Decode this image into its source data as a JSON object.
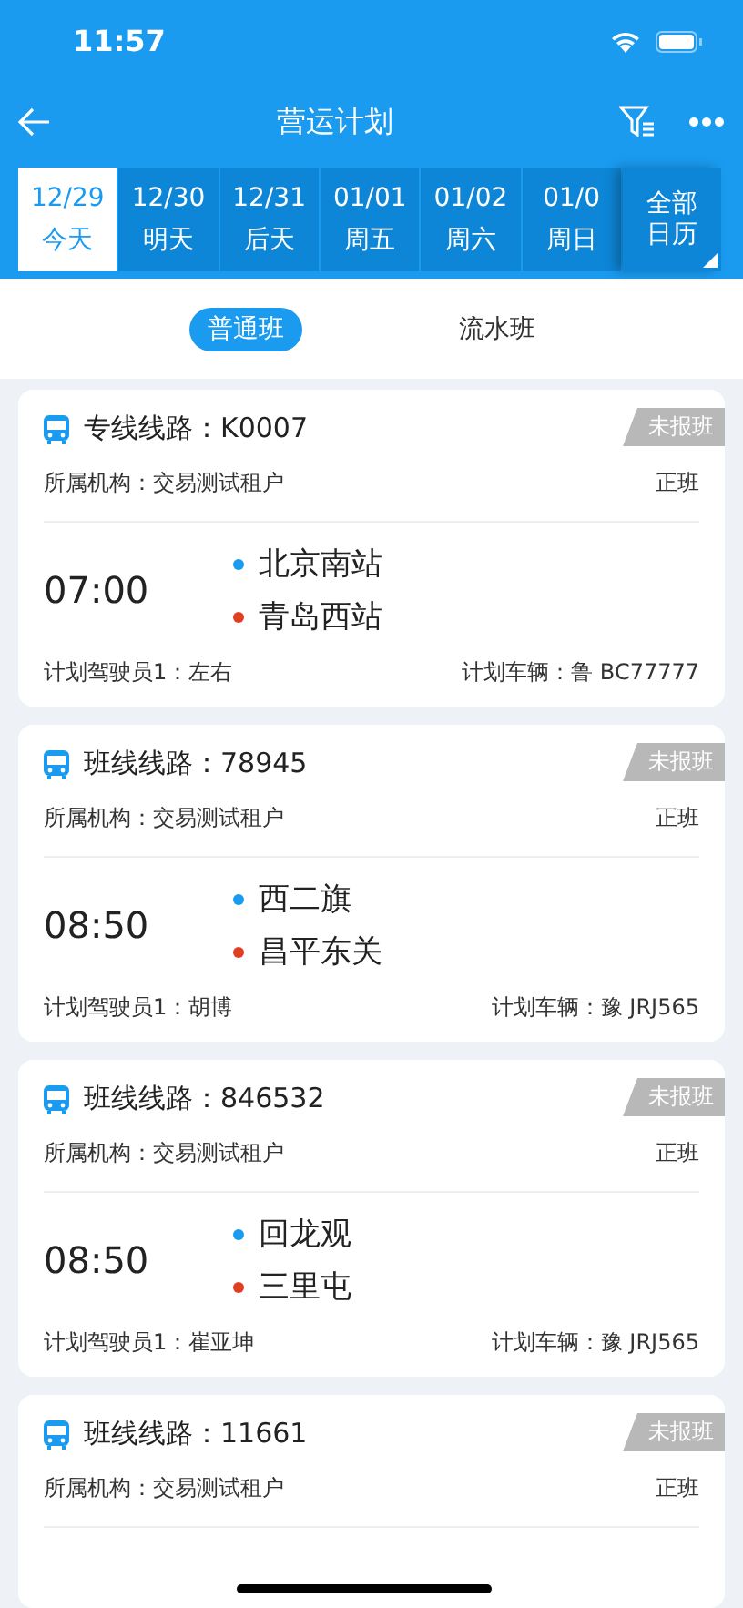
{
  "status_bar": {
    "time": "11:57"
  },
  "nav": {
    "title": "营运计划"
  },
  "dates": [
    {
      "date": "12/29",
      "day": "今天",
      "selected": true
    },
    {
      "date": "12/30",
      "day": "明天",
      "selected": false
    },
    {
      "date": "12/31",
      "day": "后天",
      "selected": false
    },
    {
      "date": "01/01",
      "day": "周五",
      "selected": false
    },
    {
      "date": "01/02",
      "day": "周六",
      "selected": false
    },
    {
      "date": "01/0",
      "day": "周日",
      "selected": false
    }
  ],
  "calendar_button": {
    "label": "全部日历"
  },
  "segments": [
    {
      "label": "普通班",
      "selected": true
    },
    {
      "label": "流水班",
      "selected": false
    }
  ],
  "cards": [
    {
      "route": "专线线路：K0007",
      "badge": "未报班",
      "org": "所属机构：交易测试租户",
      "type": "正班",
      "time": "07:00",
      "from": "北京南站",
      "to": "青岛西站",
      "driver": "计划驾驶员1：左右",
      "vehicle": "计划车辆：鲁 BC77777"
    },
    {
      "route": "班线线路：78945",
      "badge": "未报班",
      "org": "所属机构：交易测试租户",
      "type": "正班",
      "time": "08:50",
      "from": "西二旗",
      "to": "昌平东关",
      "driver": "计划驾驶员1：胡博",
      "vehicle": "计划车辆：豫 JRJ565"
    },
    {
      "route": "班线线路：846532",
      "badge": "未报班",
      "org": "所属机构：交易测试租户",
      "type": "正班",
      "time": "08:50",
      "from": "回龙观",
      "to": "三里屯",
      "driver": "计划驾驶员1：崔亚坤",
      "vehicle": "计划车辆：豫 JRJ565"
    },
    {
      "route": "班线线路：11661",
      "badge": "未报班",
      "org": "所属机构：交易测试租户",
      "type": "正班"
    }
  ]
}
